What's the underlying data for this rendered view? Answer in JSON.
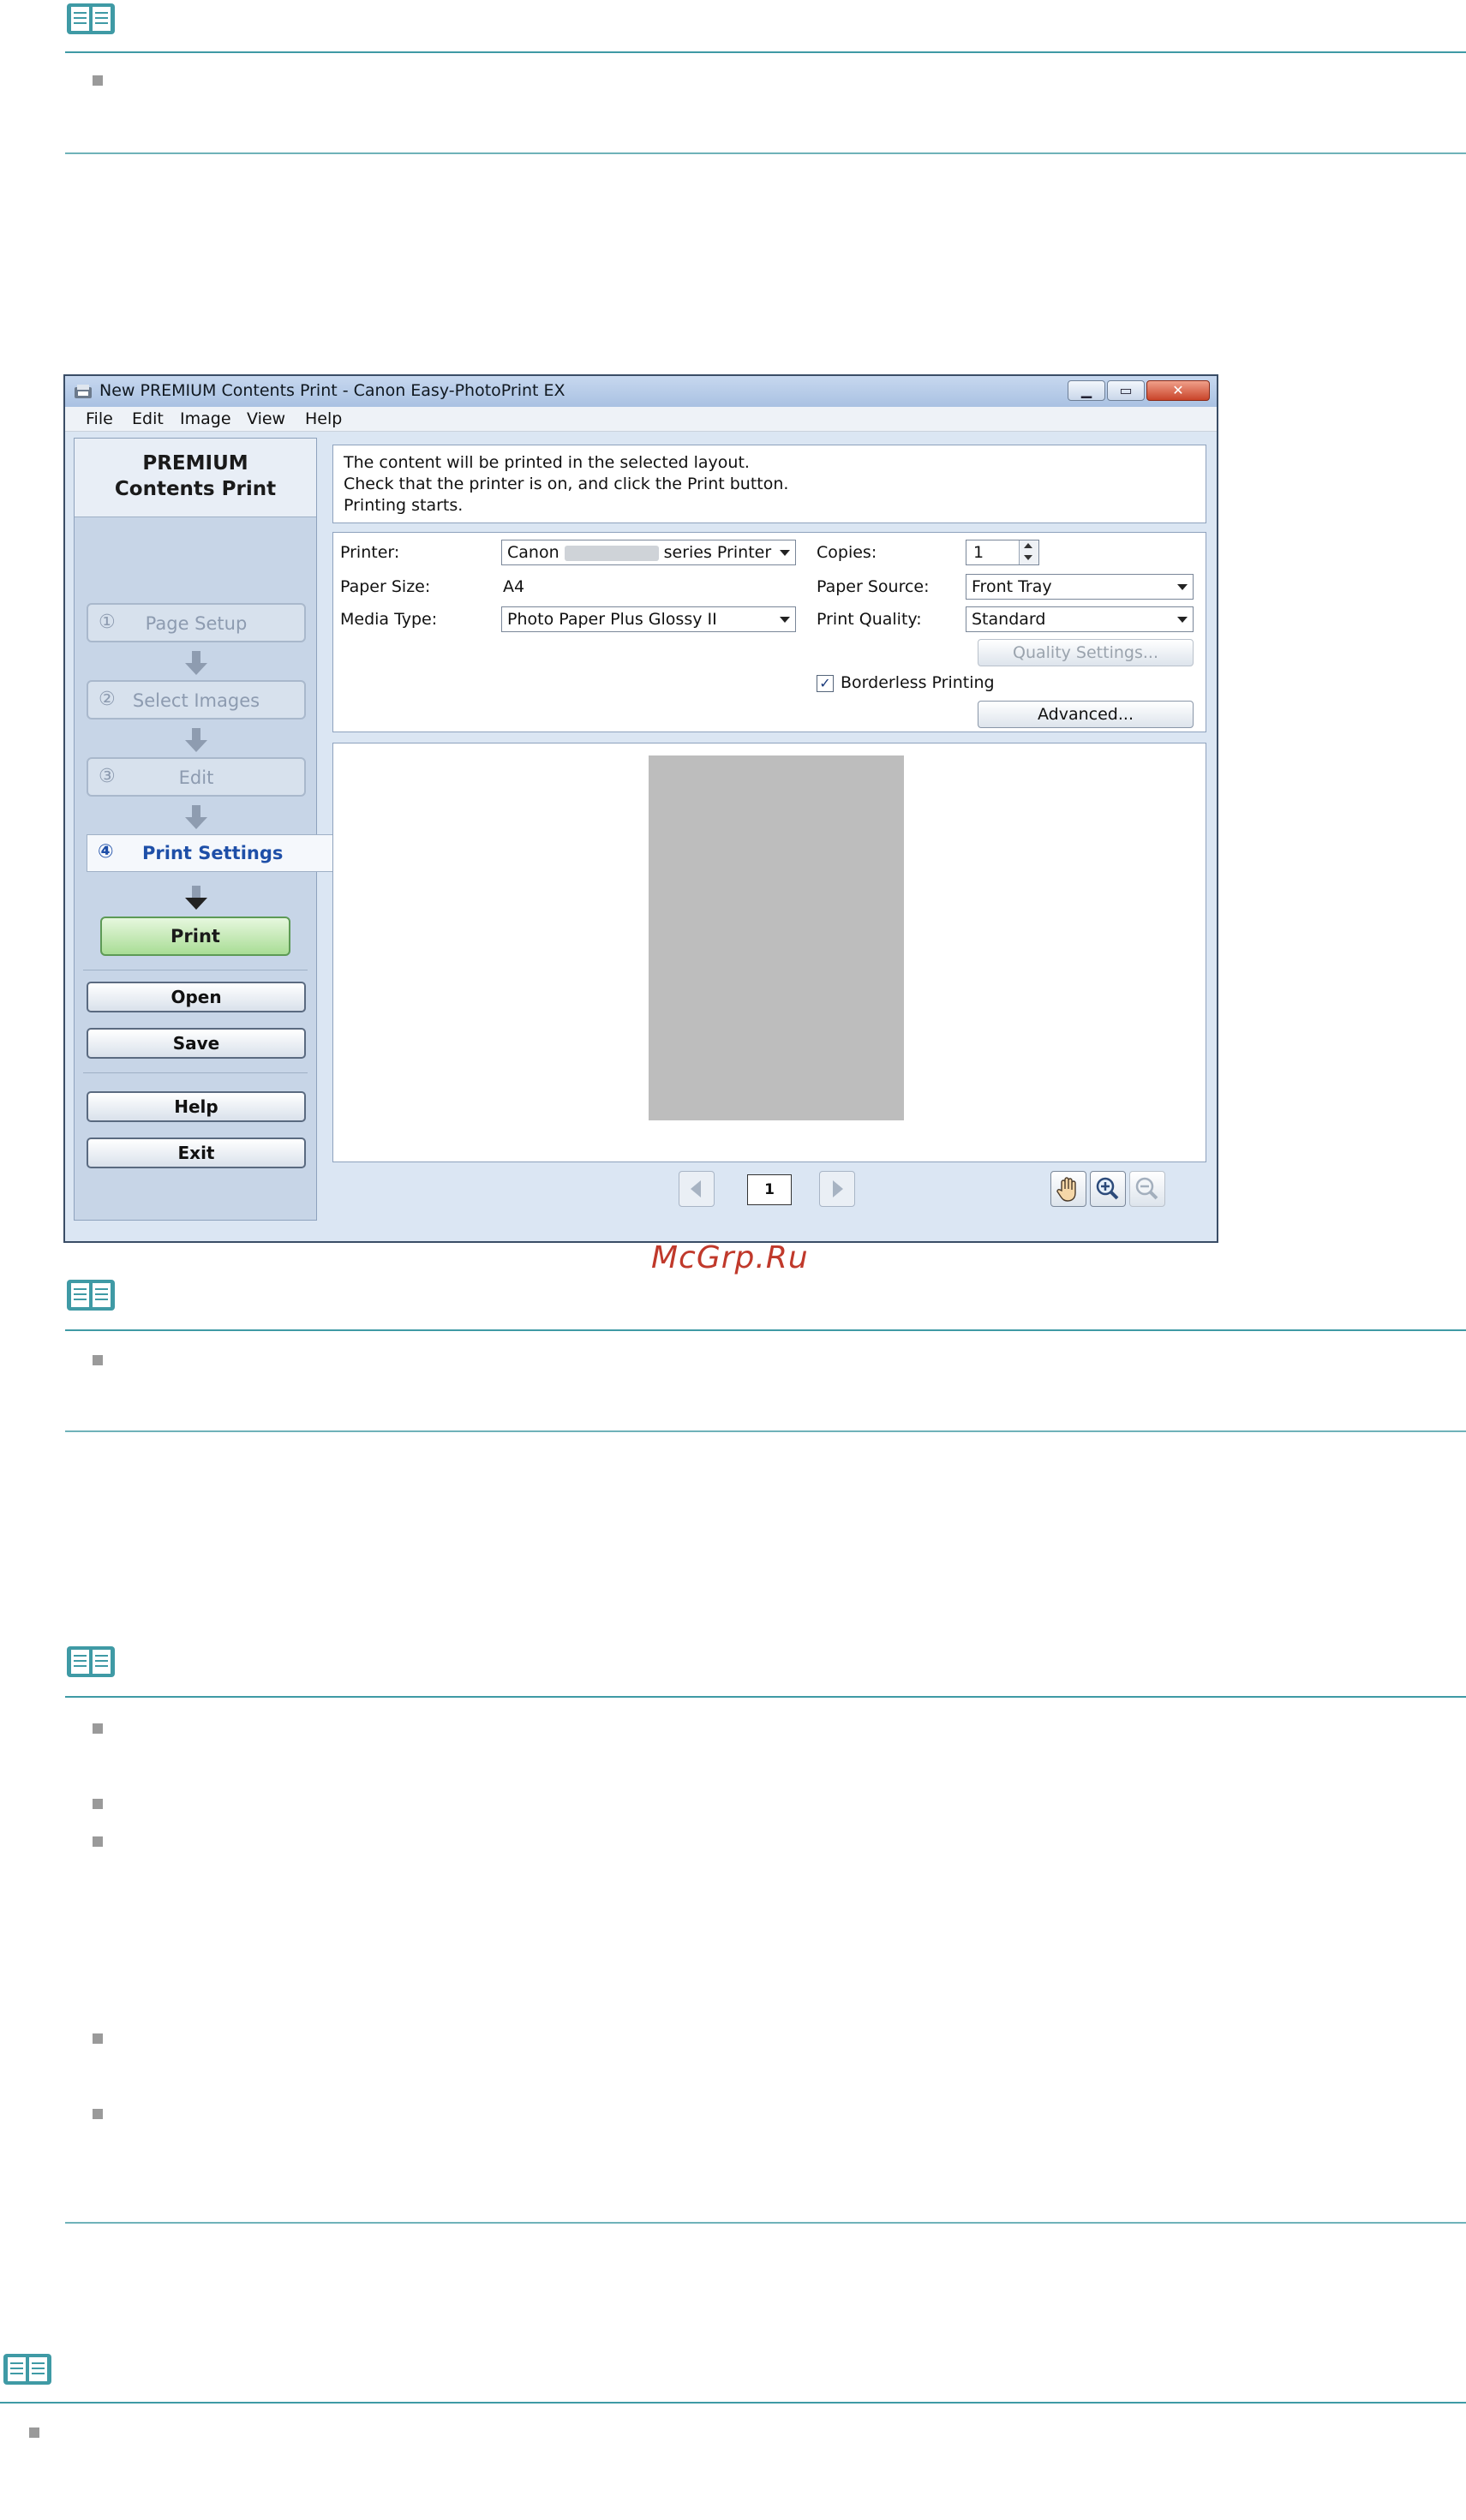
{
  "watermark": "McGrp.Ru",
  "window": {
    "title": "New PREMIUM Contents Print - Canon Easy-PhotoPrint EX",
    "menu": [
      "File",
      "Edit",
      "Image",
      "View",
      "Help"
    ],
    "left_title_line1": "PREMIUM",
    "left_title_line2": "Contents Print",
    "steps": [
      {
        "num": "①",
        "label": "Page Setup"
      },
      {
        "num": "②",
        "label": "Select Images"
      },
      {
        "num": "③",
        "label": "Edit"
      },
      {
        "num": "④",
        "label": "Print Settings"
      }
    ],
    "buttons": {
      "print": "Print",
      "open": "Open",
      "save": "Save",
      "help": "Help",
      "exit": "Exit",
      "quality_settings": "Quality Settings...",
      "advanced": "Advanced..."
    },
    "info_lines": [
      "The content will be printed in the selected layout.",
      "Check that the printer is on, and click the Print button.",
      "Printing starts."
    ],
    "settings": {
      "printer_label": "Printer:",
      "printer_value_prefix": "Canon",
      "printer_value_suffix": "series Printer",
      "paper_size_label": "Paper Size:",
      "paper_size_value": "A4",
      "media_type_label": "Media Type:",
      "media_type_value": "Photo Paper Plus Glossy II",
      "copies_label": "Copies:",
      "copies_value": "1",
      "paper_source_label": "Paper Source:",
      "paper_source_value": "Front Tray",
      "print_quality_label": "Print Quality:",
      "print_quality_value": "Standard",
      "borderless_label": "Borderless Printing",
      "borderless_checked": true
    },
    "page_number": "1",
    "icons": {
      "hand": "hand-icon",
      "zoom_in": "zoom-in-icon",
      "zoom_out": "zoom-out-icon"
    }
  },
  "colors": {
    "note_line": "#3f9aa5",
    "print_button": "#a9dd95",
    "active_step_text": "#1e4fa8",
    "watermark": "#c0392b"
  }
}
